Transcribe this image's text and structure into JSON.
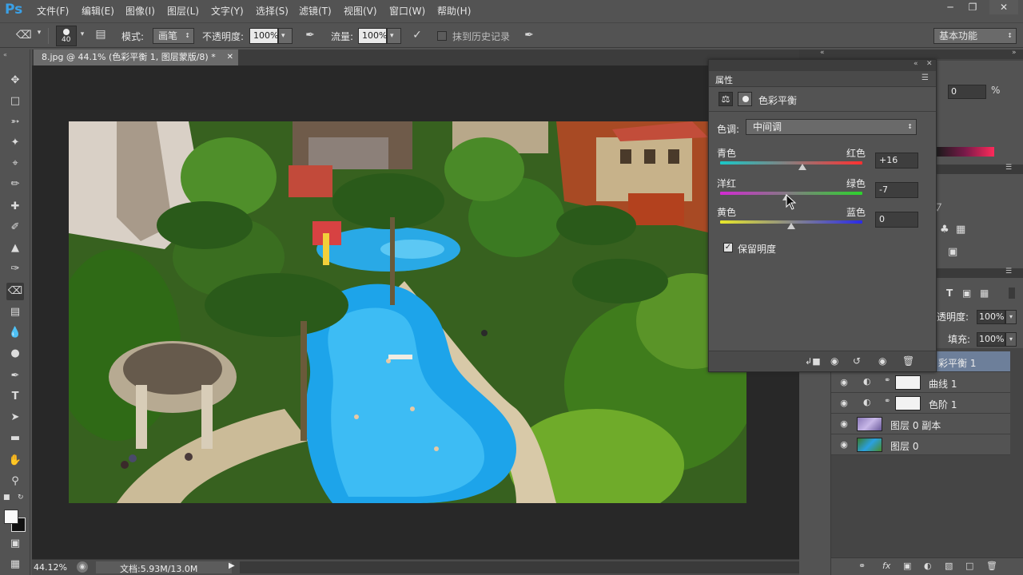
{
  "app": {
    "logo": "Ps",
    "menu": [
      "文件(F)",
      "编辑(E)",
      "图像(I)",
      "图层(L)",
      "文字(Y)",
      "选择(S)",
      "滤镜(T)",
      "视图(V)",
      "窗口(W)",
      "帮助(H)"
    ]
  },
  "options": {
    "brush_size": "40",
    "mode_label": "模式:",
    "mode_value": "画笔",
    "opacity_label": "不透明度:",
    "opacity_value": "100%",
    "flow_label": "流量:",
    "flow_value": "100%",
    "history_label": "抹到历史记录",
    "workspace": "基本功能"
  },
  "document": {
    "tab_title": "8.jpg @ 44.1% (色彩平衡 1, 图层蒙版/8) *",
    "zoom": "44.12%",
    "doc_info": "文档:5.93M/13.0M"
  },
  "properties": {
    "panel_title": "属性",
    "adjustment_name": "色彩平衡",
    "tone_label": "色调:",
    "tone_value": "中间调",
    "sliders": [
      {
        "left": "青色",
        "right": "红色",
        "value": "+16",
        "level": 0.58,
        "gradient": "linear-gradient(90deg,#19c7c7,#ff3030)"
      },
      {
        "left": "洋红",
        "right": "绿色",
        "value": "-7",
        "level": 0.465,
        "gradient": "linear-gradient(90deg,#d22ad2,#2cd42c)"
      },
      {
        "left": "黄色",
        "right": "蓝色",
        "value": "0",
        "level": 0.5,
        "gradient": "linear-gradient(90deg,#e8e82a,#2a2ae8)"
      }
    ],
    "preserve_label": "保留明度",
    "preserve_checked": true
  },
  "behind_panel": {
    "percent_value": "0",
    "percent_sign": "%"
  },
  "layers": {
    "opacity_label": "透明度:",
    "opacity_value": "100%",
    "fill_label": "填充:",
    "fill_value": "100%",
    "rows": [
      {
        "name": "彩平衡 1",
        "selected": true
      },
      {
        "name": "曲线 1",
        "selected": false
      },
      {
        "name": "色阶 1",
        "selected": false
      },
      {
        "name": "图层 0 副本",
        "selected": false
      },
      {
        "name": "图层 0",
        "selected": false
      }
    ]
  }
}
